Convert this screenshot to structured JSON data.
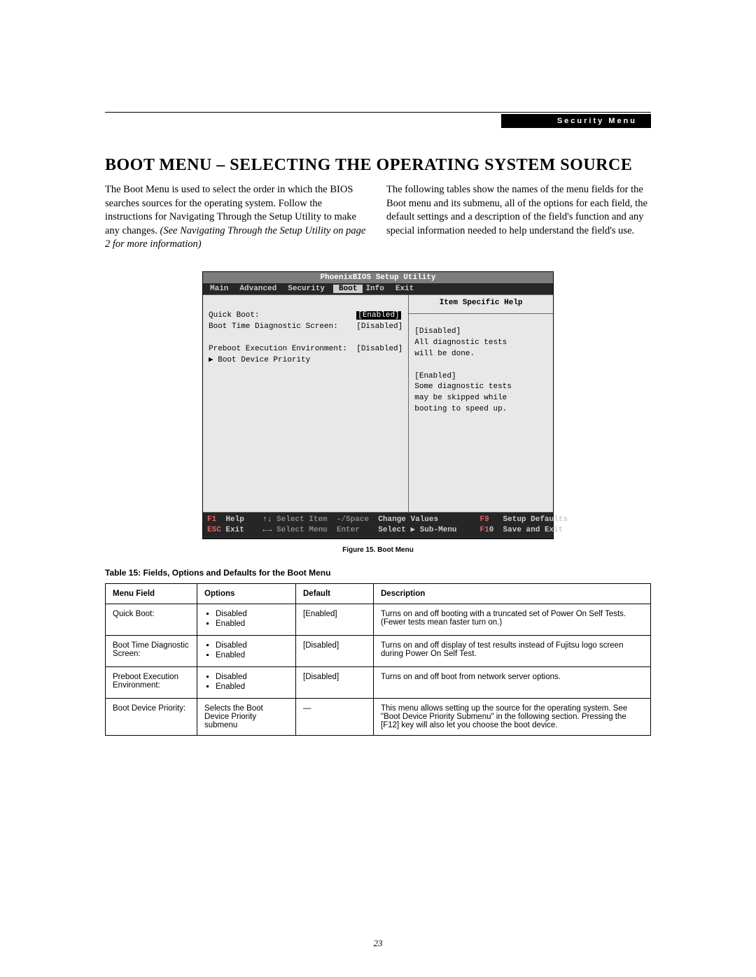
{
  "header": {
    "section_label": "Security Menu"
  },
  "title": "BOOT MENU – SELECTING THE OPERATING SYSTEM SOURCE",
  "intro": {
    "left_plain": "The Boot Menu is used to select the order in which the BIOS searches sources for the operating system. Follow the instructions for Navigating Through the Setup Utility to make any changes. ",
    "left_italic": "(See Navigating Through the Setup Utility on page 2 for more information)",
    "right": "The following tables show the names of the menu fields for the Boot menu and its submenu, all of the options for each field, the default settings and a description of the field's function and any special information needed to help understand the field's use."
  },
  "bios": {
    "title": "PhoenixBIOS Setup Utility",
    "tabs": [
      "Main",
      "Advanced",
      "Security",
      "Boot",
      "Info",
      "Exit"
    ],
    "active_tab": "Boot",
    "rows": [
      {
        "label": "Quick Boot:",
        "value": "[Enabled]",
        "selected": true,
        "indent": 0
      },
      {
        "label": "Boot Time Diagnostic Screen:",
        "value": "[Disabled]",
        "selected": false,
        "indent": 0
      },
      {
        "label": "",
        "value": "",
        "selected": false,
        "indent": 0
      },
      {
        "label": "Preboot Execution Environment:",
        "value": "[Disabled]",
        "selected": false,
        "indent": 0
      },
      {
        "label": "▶ Boot Device Priority",
        "value": "",
        "selected": false,
        "indent": 0
      }
    ],
    "help_title": "Item Specific Help",
    "help_lines": [
      "[Disabled]",
      "All diagnostic tests",
      "will be done.",
      "",
      "[Enabled]",
      "Some diagnostic tests",
      "may be skipped while",
      "booting to speed up."
    ],
    "footer": {
      "l1": "F1  Help    ↑↓ Select Item  -/Space  Change Values         F9   Setup Defaults",
      "l2": "ESC Exit    ←→ Select Menu  Enter    Select ▶ Sub-Menu     F10  Save and Exit"
    }
  },
  "figure_caption": "Figure 15.  Boot Menu",
  "table_caption": "Table 15: Fields, Options and Defaults for the Boot Menu",
  "table": {
    "headers": [
      "Menu Field",
      "Options",
      "Default",
      "Description"
    ],
    "rows": [
      {
        "field": "Quick Boot:",
        "options": [
          "Disabled",
          "Enabled"
        ],
        "default": "[Enabled]",
        "desc": "Turns on and off booting with a truncated set of Power On Self Tests. (Fewer tests mean faster turn on.)"
      },
      {
        "field": "Boot Time Diagnostic Screen:",
        "options": [
          "Disabled",
          "Enabled"
        ],
        "default": "[Disabled]",
        "desc": "Turns on and off display of test results instead of Fujitsu logo screen during Power On Self Test."
      },
      {
        "field": "Preboot Execution Environment:",
        "options": [
          "Disabled",
          "Enabled"
        ],
        "default": "[Disabled]",
        "desc": "Turns on and off boot from network server options."
      },
      {
        "field": "Boot Device Priority:",
        "options_text": "Selects the Boot Device Priority submenu",
        "default": "—",
        "desc": "This menu allows setting up the source for the operating system. See \"Boot Device Priority Submenu\" in the following section. Pressing the [F12] key will also let you choose the boot device."
      }
    ]
  },
  "page_number": "23"
}
